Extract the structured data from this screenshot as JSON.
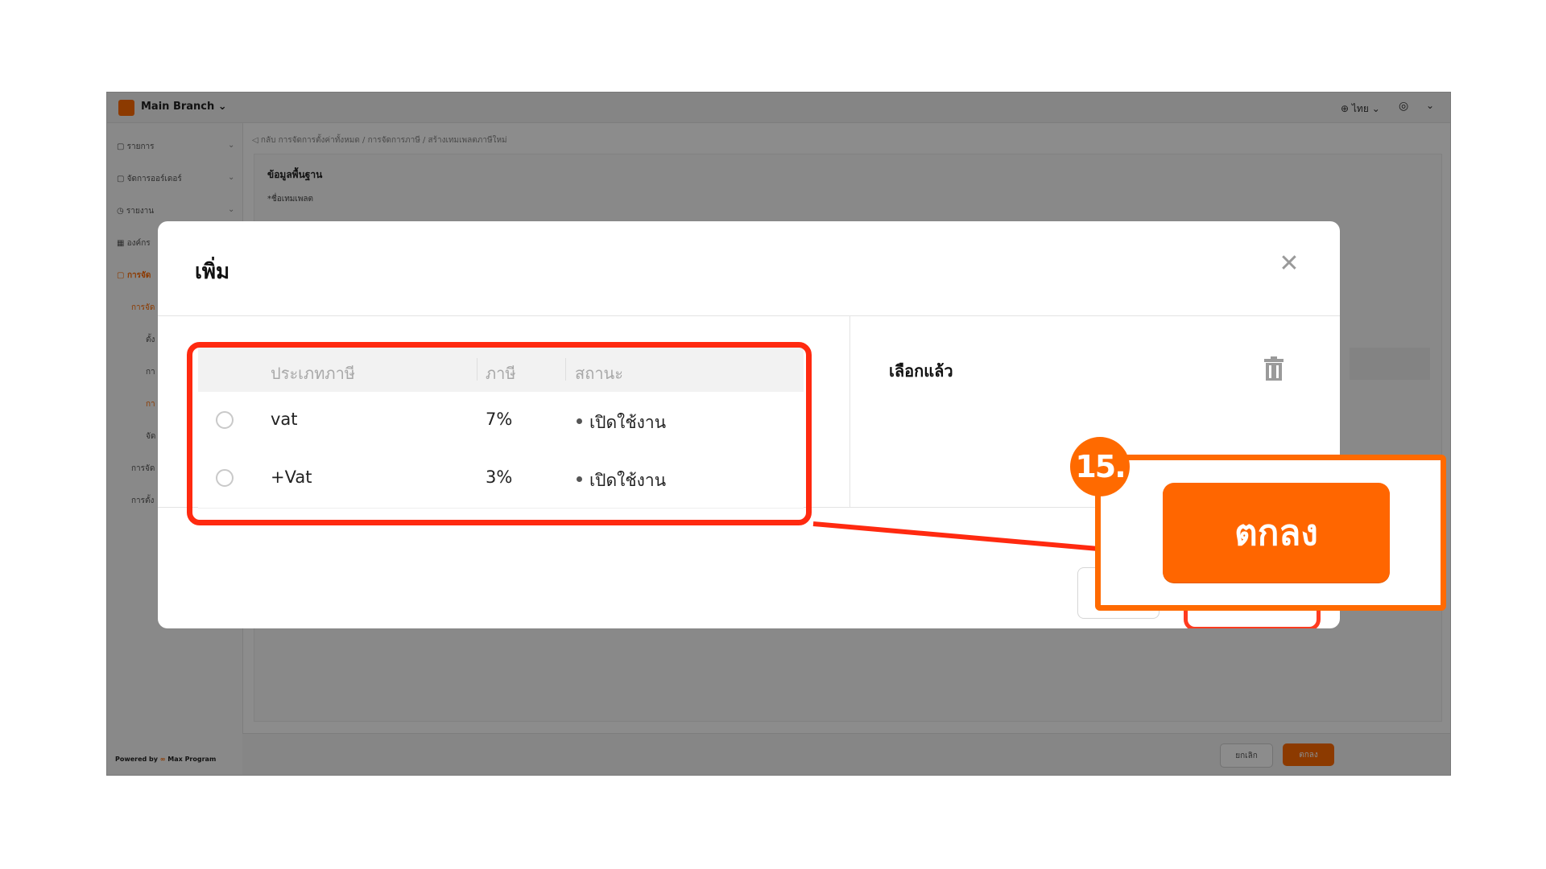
{
  "app": {
    "branch_name": "Main Branch",
    "language": "ไทย",
    "powered_by": "Powered by",
    "powered_brand": "Max Program",
    "breadcrumb": "กลับ   การจัดการตั้งค่าทั้งหมด  /  การจัดการภาษี  /  สร้างเทมเพลตภาษีใหม่",
    "section_title": "ข้อมูลพื้นฐาน",
    "field_label": "*ชื่อเทมเพลต",
    "sidebar": {
      "items": [
        {
          "label": "รายการ"
        },
        {
          "label": "จัดการออร์เดอร์"
        },
        {
          "label": "รายงาน"
        },
        {
          "label": "องค์กร"
        },
        {
          "label": "การจัด"
        },
        {
          "label": "การจัด"
        },
        {
          "label": "ตั้ง"
        },
        {
          "label": "กา"
        },
        {
          "label": "กา"
        },
        {
          "label": "จัด"
        },
        {
          "label": "การจัด"
        },
        {
          "label": "การตั้ง"
        }
      ]
    },
    "footer": {
      "cancel_label": "ยกเลิก",
      "ok_label": "ตกลง"
    }
  },
  "modal": {
    "title": "เพิ่ม",
    "close_icon": "close-icon",
    "table": {
      "columns": [
        "ประเภทภาษี",
        "ภาษี",
        "สถานะ"
      ],
      "rows": [
        {
          "type": "vat",
          "rate": "7%",
          "status": "เปิดใช้งาน"
        },
        {
          "type": "+Vat",
          "rate": "3%",
          "status": "เปิดใช้งาน"
        }
      ]
    },
    "selected": {
      "label": "เลือกแล้ว",
      "clear_icon": "trash-icon"
    }
  },
  "annotation": {
    "step": "15.",
    "ok_label": "ตกลง",
    "highlight_color": "#ff2a10",
    "accent_color": "#ff6a00"
  }
}
